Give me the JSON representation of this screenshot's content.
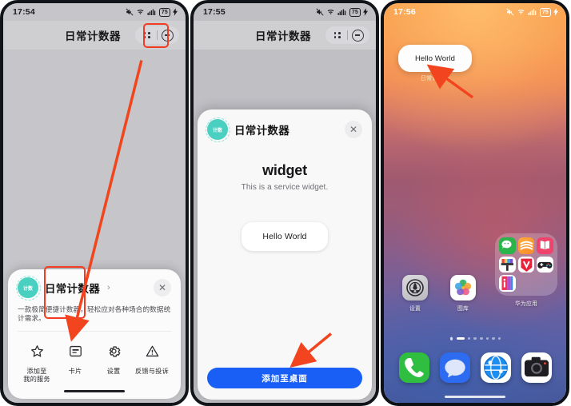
{
  "phone1": {
    "status": {
      "time": "17:54",
      "battery": "75"
    },
    "appbar": {
      "title": "日常计数器",
      "grip_icon": "drag-dots-icon",
      "minimize_icon": "circle-minus-icon"
    },
    "sheet": {
      "app_name": "日常计数器",
      "app_icon_text": "计数",
      "chevron": "›",
      "close": "✕",
      "description": "一款极简便捷计数器，轻松应对各种场合的数据统计需求。",
      "actions": [
        {
          "icon": "star-icon",
          "label": "添加至\n我的服务"
        },
        {
          "icon": "card-icon",
          "label": "卡片"
        },
        {
          "icon": "gear-icon",
          "label": "设置"
        },
        {
          "icon": "warning-icon",
          "label": "反馈与投诉"
        }
      ]
    }
  },
  "phone2": {
    "status": {
      "time": "17:55",
      "battery": "75"
    },
    "appbar": {
      "title": "日常计数器"
    },
    "dialog": {
      "app_name": "日常计数器",
      "app_icon_text": "计数",
      "close": "✕",
      "widget_title": "widget",
      "widget_subtitle": "This is a service widget.",
      "preview_card_text": "Hello World",
      "primary_button": "添加至桌面"
    }
  },
  "phone3": {
    "status": {
      "time": "17:56",
      "battery": "75"
    },
    "widget": {
      "text": "Hello World",
      "label": "日常计数器"
    },
    "apps": [
      {
        "name": "设置",
        "icon": "settings-icon"
      },
      {
        "name": "图库",
        "icon": "gallery-icon"
      }
    ],
    "folder": {
      "label": "华为应用",
      "icons": [
        "wechat-icon",
        "notes-icon",
        "book-icon",
        "brush-icon",
        "vmall-icon",
        "game-icon",
        "info-icon"
      ]
    },
    "dock": [
      {
        "name": "phone-icon"
      },
      {
        "name": "messages-icon"
      },
      {
        "name": "browser-icon"
      },
      {
        "name": "camera-icon"
      }
    ],
    "pager": {
      "pages": 7,
      "active": 1
    }
  },
  "annotations": {
    "highlight_color": "#f33b22",
    "arrow_color": "#f2451f"
  }
}
